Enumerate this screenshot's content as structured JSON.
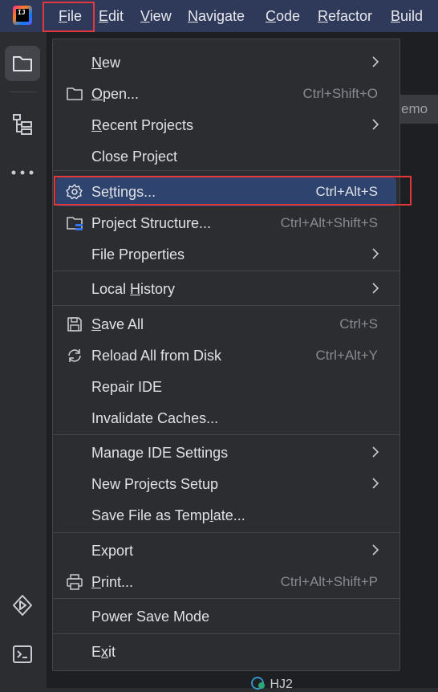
{
  "menubar": {
    "items": [
      {
        "label": "File",
        "mnemonic": "F",
        "rest": "ile"
      },
      {
        "label": "Edit",
        "mnemonic": "E",
        "rest": "dit"
      },
      {
        "label": "View",
        "mnemonic": "V",
        "rest": "iew"
      },
      {
        "label": "Navigate",
        "mnemonic": "N",
        "rest": "avigate"
      },
      {
        "label": "Code",
        "mnemonic": "C",
        "rest": "ode"
      },
      {
        "label": "Refactor",
        "mnemonic": "R",
        "rest": "efactor"
      },
      {
        "label": "Build",
        "mnemonic": "B",
        "rest": "uild"
      }
    ],
    "logo_text": "IJ"
  },
  "background": {
    "tab_fragment": "emo",
    "bottom_fragment": "HJ2"
  },
  "file_menu": {
    "items": [
      {
        "pre": "",
        "mn": "N",
        "post": "ew",
        "shortcut": "",
        "submenu": true,
        "icon": ""
      },
      {
        "pre": "",
        "mn": "O",
        "post": "pen...",
        "shortcut": "Ctrl+Shift+O",
        "submenu": false,
        "icon": "folder-icon"
      },
      {
        "pre": "",
        "mn": "R",
        "post": "ecent Projects",
        "shortcut": "",
        "submenu": true,
        "icon": ""
      },
      {
        "pre": "Close Project",
        "mn": "",
        "post": "",
        "shortcut": "",
        "submenu": false,
        "icon": ""
      },
      {
        "pre": "Se",
        "mn": "t",
        "post": "tings...",
        "shortcut": "Ctrl+Alt+S",
        "submenu": false,
        "icon": "gear-icon"
      },
      {
        "pre": "Project Structure...",
        "mn": "",
        "post": "",
        "shortcut": "Ctrl+Alt+Shift+S",
        "submenu": false,
        "icon": "project-structure-icon"
      },
      {
        "pre": "File Properties",
        "mn": "",
        "post": "",
        "shortcut": "",
        "submenu": true,
        "icon": ""
      },
      {
        "pre": "Local ",
        "mn": "H",
        "post": "istory",
        "shortcut": "",
        "submenu": true,
        "icon": ""
      },
      {
        "pre": "",
        "mn": "S",
        "post": "ave All",
        "shortcut": "Ctrl+S",
        "submenu": false,
        "icon": "save-icon"
      },
      {
        "pre": "Reload All from Disk",
        "mn": "",
        "post": "",
        "shortcut": "Ctrl+Alt+Y",
        "submenu": false,
        "icon": "reload-icon"
      },
      {
        "pre": "Repair IDE",
        "mn": "",
        "post": "",
        "shortcut": "",
        "submenu": false,
        "icon": ""
      },
      {
        "pre": "Invalidate Caches...",
        "mn": "",
        "post": "",
        "shortcut": "",
        "submenu": false,
        "icon": ""
      },
      {
        "pre": "Manage IDE Settings",
        "mn": "",
        "post": "",
        "shortcut": "",
        "submenu": true,
        "icon": ""
      },
      {
        "pre": "New Projects Setup",
        "mn": "",
        "post": "",
        "shortcut": "",
        "submenu": true,
        "icon": ""
      },
      {
        "pre": "Save File as Temp",
        "mn": "l",
        "post": "ate...",
        "shortcut": "",
        "submenu": false,
        "icon": ""
      },
      {
        "pre": "Export",
        "mn": "",
        "post": "",
        "shortcut": "",
        "submenu": true,
        "icon": ""
      },
      {
        "pre": "",
        "mn": "P",
        "post": "rint...",
        "shortcut": "Ctrl+Alt+Shift+P",
        "submenu": false,
        "icon": "print-icon"
      },
      {
        "pre": "Power Save Mode",
        "mn": "",
        "post": "",
        "shortcut": "",
        "submenu": false,
        "icon": ""
      },
      {
        "pre": "E",
        "mn": "x",
        "post": "it",
        "shortcut": "",
        "submenu": false,
        "icon": ""
      }
    ]
  },
  "colors": {
    "menubar_bg": "#2f3a5a",
    "selection_bg": "#2e436e",
    "highlight_border": "#e5383b"
  }
}
